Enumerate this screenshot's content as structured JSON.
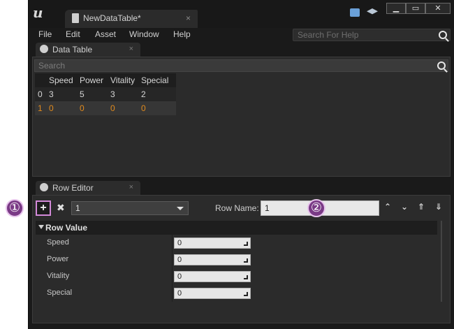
{
  "window": {
    "document_tab": "NewDataTable*",
    "close_glyph": "×"
  },
  "menu": {
    "items": [
      "File",
      "Edit",
      "Asset",
      "Window",
      "Help"
    ],
    "search_placeholder": "Search For Help"
  },
  "data_table_panel": {
    "tab_label": "Data Table",
    "search_placeholder": "Search",
    "columns": [
      "",
      "Speed",
      "Power",
      "Vitality",
      "Special"
    ],
    "rows": [
      [
        "0",
        "3",
        "5",
        "3",
        "2"
      ],
      [
        "1",
        "0",
        "0",
        "0",
        "0"
      ]
    ],
    "selected_row": 1,
    "selected_color": "#e08a1e"
  },
  "row_editor_panel": {
    "tab_label": "Row Editor",
    "row_selector_value": "1",
    "row_name_label": "Row Name:",
    "row_name_value": "1",
    "section_title": "Row Value",
    "properties": [
      {
        "label": "Speed",
        "value": "0"
      },
      {
        "label": "Power",
        "value": "0"
      },
      {
        "label": "Vitality",
        "value": "0"
      },
      {
        "label": "Special",
        "value": "0"
      }
    ]
  },
  "callouts": {
    "one": "①",
    "two": "②"
  },
  "icons": {
    "logo": "unreal-logo-icon",
    "add": "plus-icon",
    "remove": "x-icon",
    "move_up": "chevron-up-icon",
    "move_down": "chevron-down-icon",
    "move_top": "double-chevron-up-icon",
    "move_bottom": "double-chevron-down-icon"
  },
  "colors": {
    "accent_callout": "#7a3a86",
    "highlight_border": "#d38ad9"
  }
}
